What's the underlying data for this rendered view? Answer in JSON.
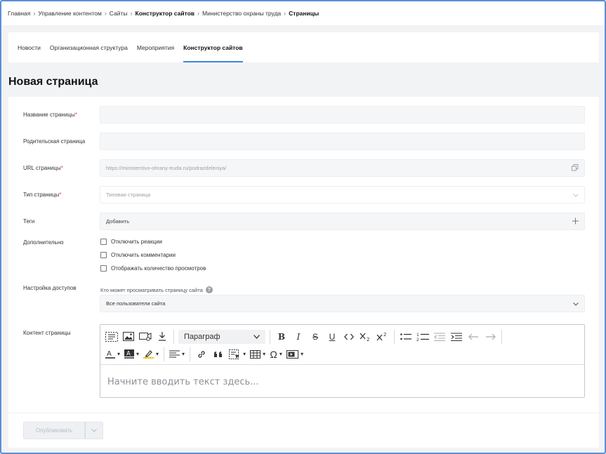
{
  "breadcrumb": {
    "items": [
      "Главная",
      "Управление контентом",
      "Сайты",
      "Конструктор сайтов",
      "Министерство охраны труда",
      "Страницы"
    ]
  },
  "tabs": [
    "Новости",
    "Организационная структура",
    "Мероприятия",
    "Конструктор сайтов"
  ],
  "page_title": "Новая страница",
  "form": {
    "page_name_label": "Название страницы",
    "parent_page_label": "Родительская страница",
    "url_label": "URL страницы",
    "url_value": "https://ministerstvo-ohrany-truda.ru/podrazdeleniya/",
    "type_label": "Тип страницы",
    "type_placeholder": "Типовая страница",
    "tags_label": "Теги",
    "tags_placeholder": "Добавить",
    "extra_label": "Дополнительно",
    "checks": [
      "Отключить реакции",
      "Отключить комментарии",
      "Отображать количество просмотров"
    ],
    "access_label": "Настройка доступов",
    "access_hint": "Кто может просматривать страницу сайта",
    "access_value": "Все пользователи сайта",
    "content_label": "Контент страницы",
    "required_mark": "*"
  },
  "editor": {
    "paragraph_select": "Параграф",
    "placeholder": "Начните вводить текст здесь..."
  },
  "footer": {
    "publish_label": "Опубликовать"
  }
}
